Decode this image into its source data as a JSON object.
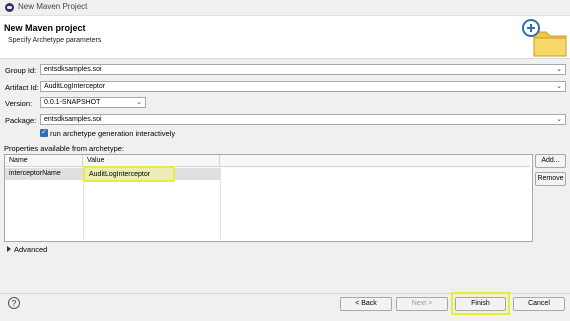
{
  "window": {
    "title": "New Maven Project"
  },
  "header": {
    "title": "New Maven project",
    "subtitle": "Specify Archetype parameters"
  },
  "form": {
    "group_id": {
      "label": "Group Id:",
      "value": "entsdksamples.soi"
    },
    "artifact_id": {
      "label": "Artifact Id:",
      "value": "AuditLogInterceptor"
    },
    "version": {
      "label": "Version:",
      "value": "0.0.1-SNAPSHOT"
    },
    "package": {
      "label": "Package:",
      "value": "entsdksamples.soi"
    },
    "interactive": {
      "label": "run archetype generation interactively",
      "checked": true
    }
  },
  "properties": {
    "label": "Properties available from archetype:",
    "columns": [
      "Name",
      "Value"
    ],
    "rows": [
      {
        "name": "interceptorName",
        "value": "AuditLogInterceptor"
      }
    ],
    "add_label": "Add...",
    "remove_label": "Remove"
  },
  "advanced": {
    "label": "Advanced"
  },
  "footer": {
    "help": "?",
    "back": "< Back",
    "next": "Next >",
    "finish": "Finish",
    "cancel": "Cancel"
  },
  "colors": {
    "highlight": "#ebeb3c",
    "checkbox": "#2f6db5",
    "folder": "#f2c94c"
  },
  "icons": [
    "app-icon",
    "new-folder-icon",
    "plus-icon",
    "chevron-down-icon",
    "expand-arrow-icon",
    "help-icon"
  ]
}
